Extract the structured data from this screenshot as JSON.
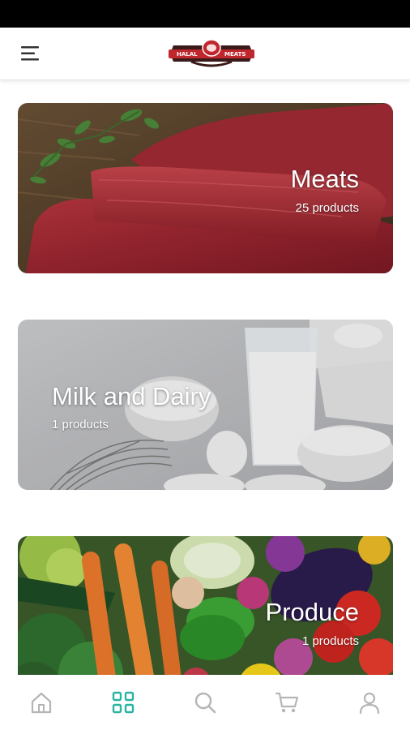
{
  "header": {
    "logo_left": "HALAL",
    "logo_right": "MEATS"
  },
  "categories": [
    {
      "name": "Meats",
      "count": "25 products"
    },
    {
      "name": "Milk and Dairy",
      "count": "1 products"
    },
    {
      "name": "Produce",
      "count": "1 products"
    }
  ],
  "nav": {
    "items": [
      {
        "icon": "home-icon"
      },
      {
        "icon": "grid-icon",
        "active": true
      },
      {
        "icon": "search-icon"
      },
      {
        "icon": "cart-icon"
      },
      {
        "icon": "user-icon"
      }
    ],
    "active_color": "#2bb3a3",
    "inactive_color": "#b5b5b5"
  },
  "colors": {
    "brand_red": "#c0272d",
    "brand_dark": "#3a1a1a"
  }
}
